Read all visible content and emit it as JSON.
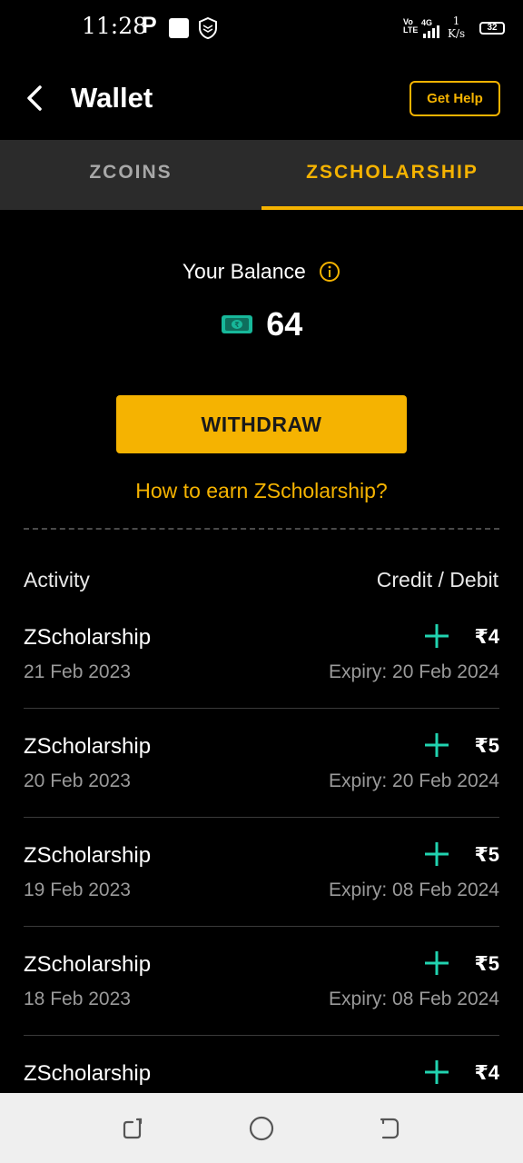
{
  "status_bar": {
    "time": "11:28",
    "p_icon_text": "P",
    "volte": "Vo\nLTE",
    "network": "4G",
    "speed_value": "1",
    "speed_unit": "K/s",
    "battery": "32",
    "icons": [
      "p-icon",
      "square-app-icon",
      "shield-app-icon",
      "signal-icon",
      "battery-icon"
    ]
  },
  "header": {
    "title": "Wallet",
    "help_label": "Get Help",
    "back_icon": "chevron-left-icon"
  },
  "tabs": [
    {
      "label": "ZCOINS",
      "active": false
    },
    {
      "label": "ZSCHOLARSHIP",
      "active": true
    }
  ],
  "balance": {
    "label": "Your Balance",
    "value": "64",
    "info_icon": "info-icon",
    "currency_icon": "cash-icon"
  },
  "withdraw_label": "WITHDRAW",
  "earn_link": "How to earn ZScholarship?",
  "activity": {
    "left_header": "Activity",
    "right_header": "Credit / Debit",
    "transactions": [
      {
        "name": "ZScholarship",
        "date": "21 Feb 2023",
        "amount": "₹4",
        "expiry": "Expiry: 20 Feb 2024",
        "type": "credit"
      },
      {
        "name": "ZScholarship",
        "date": "20 Feb 2023",
        "amount": "₹5",
        "expiry": "Expiry: 20 Feb 2024",
        "type": "credit"
      },
      {
        "name": "ZScholarship",
        "date": "19 Feb 2023",
        "amount": "₹5",
        "expiry": "Expiry: 08 Feb 2024",
        "type": "credit"
      },
      {
        "name": "ZScholarship",
        "date": "18 Feb 2023",
        "amount": "₹5",
        "expiry": "Expiry: 08 Feb 2024",
        "type": "credit"
      },
      {
        "name": "ZScholarship",
        "date": "",
        "amount": "₹4",
        "expiry": "",
        "type": "credit"
      }
    ]
  },
  "colors": {
    "accent": "#f5b301",
    "credit": "#21d3b0",
    "background": "#000000",
    "tab_bar": "#2b2b2b"
  },
  "nav_bar": {
    "icons": [
      "recents-icon",
      "home-icon",
      "back-icon"
    ]
  }
}
